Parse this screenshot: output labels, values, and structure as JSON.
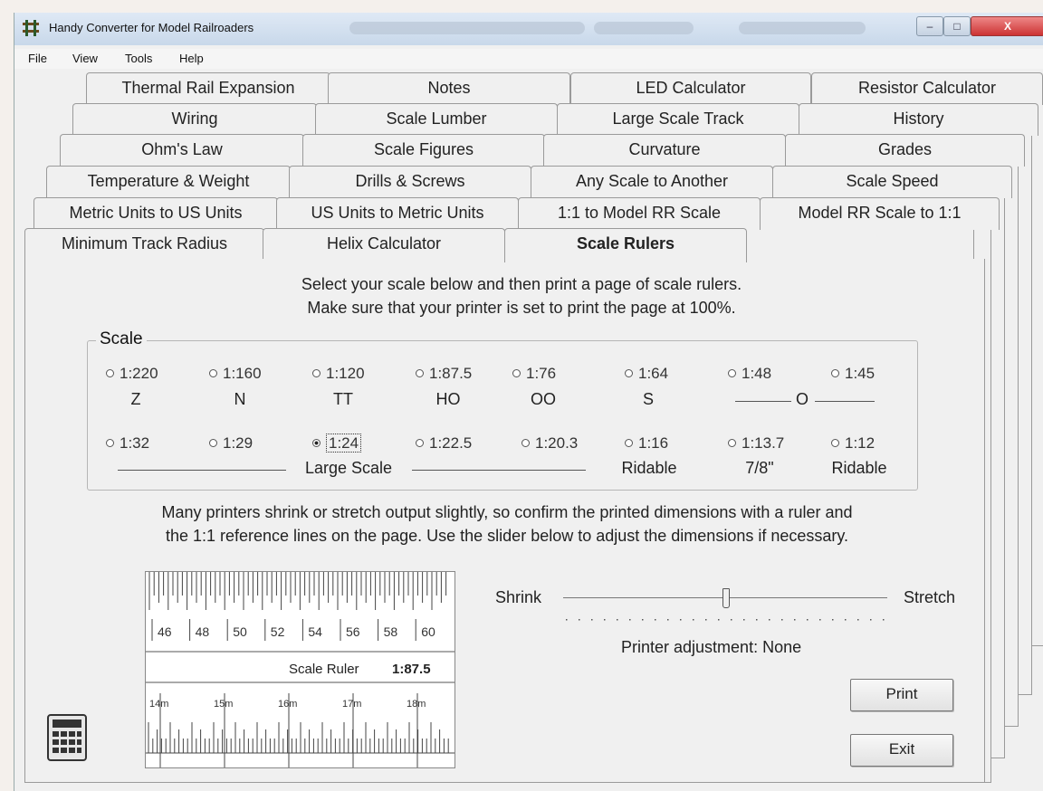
{
  "window": {
    "title": "Handy Converter for Model Railroaders"
  },
  "menu": [
    "File",
    "View",
    "Tools",
    "Help"
  ],
  "tabs": {
    "row1": [
      "Thermal Rail Expansion",
      "Notes",
      "LED Calculator",
      "Resistor Calculator"
    ],
    "row2": [
      "Wiring",
      "Scale Lumber",
      "Large Scale Track",
      "History"
    ],
    "row3": [
      "Ohm's Law",
      "Scale Figures",
      "Curvature",
      "Grades"
    ],
    "row4": [
      "Temperature & Weight",
      "Drills & Screws",
      "Any Scale to Another",
      "Scale Speed"
    ],
    "row5": [
      "Metric Units to US Units",
      "US Units to Metric Units",
      "1:1 to Model RR Scale",
      "Model RR Scale to 1:1"
    ],
    "row6": [
      "Minimum Track Radius",
      "Helix Calculator",
      "Scale Rulers"
    ]
  },
  "active_tab": "Scale Rulers",
  "instructions": {
    "line1": "Select your scale  below and then print a page of scale rulers.",
    "line2": "Make sure that your printer is set to print the page at 100%."
  },
  "scale_group": {
    "label": "Scale",
    "row1": [
      {
        "ratio": "1:220",
        "name": "Z"
      },
      {
        "ratio": "1:160",
        "name": "N"
      },
      {
        "ratio": "1:120",
        "name": "TT"
      },
      {
        "ratio": "1:87.5",
        "name": "HO"
      },
      {
        "ratio": "1:76",
        "name": "OO"
      },
      {
        "ratio": "1:64",
        "name": "S"
      },
      {
        "ratio": "1:48",
        "name": ""
      },
      {
        "ratio": "1:45",
        "name": ""
      }
    ],
    "o_label": "O",
    "row2": [
      {
        "ratio": "1:32"
      },
      {
        "ratio": "1:29"
      },
      {
        "ratio": "1:24"
      },
      {
        "ratio": "1:22.5"
      },
      {
        "ratio": "1:20.3"
      },
      {
        "ratio": "1:16"
      },
      {
        "ratio": "1:13.7"
      },
      {
        "ratio": "1:12"
      }
    ],
    "selected": "1:24",
    "large_scale_label": "Large Scale",
    "ridable_label_1": "Ridable",
    "seven_eighths_label": "7/8\"",
    "ridable_label_2": "Ridable"
  },
  "warning": {
    "line1": "Many printers shrink or stretch output slightly, so confirm the printed dimensions with a ruler and",
    "line2": "the 1:1 reference lines on the page. Use the slider below to adjust the dimensions if necessary."
  },
  "ruler_preview": {
    "top_numbers": [
      "46",
      "48",
      "50",
      "52",
      "54",
      "56",
      "58",
      "60"
    ],
    "caption": "Scale Ruler",
    "scale": "1:87.5",
    "bottom_numbers": [
      "14m",
      "15m",
      "16m",
      "17m",
      "18m"
    ]
  },
  "slider": {
    "shrink_label": "Shrink",
    "stretch_label": "Stretch",
    "position_fraction": 0.5,
    "adjustment_text": "Printer adjustment: None"
  },
  "buttons": {
    "print": "Print",
    "exit": "Exit"
  }
}
